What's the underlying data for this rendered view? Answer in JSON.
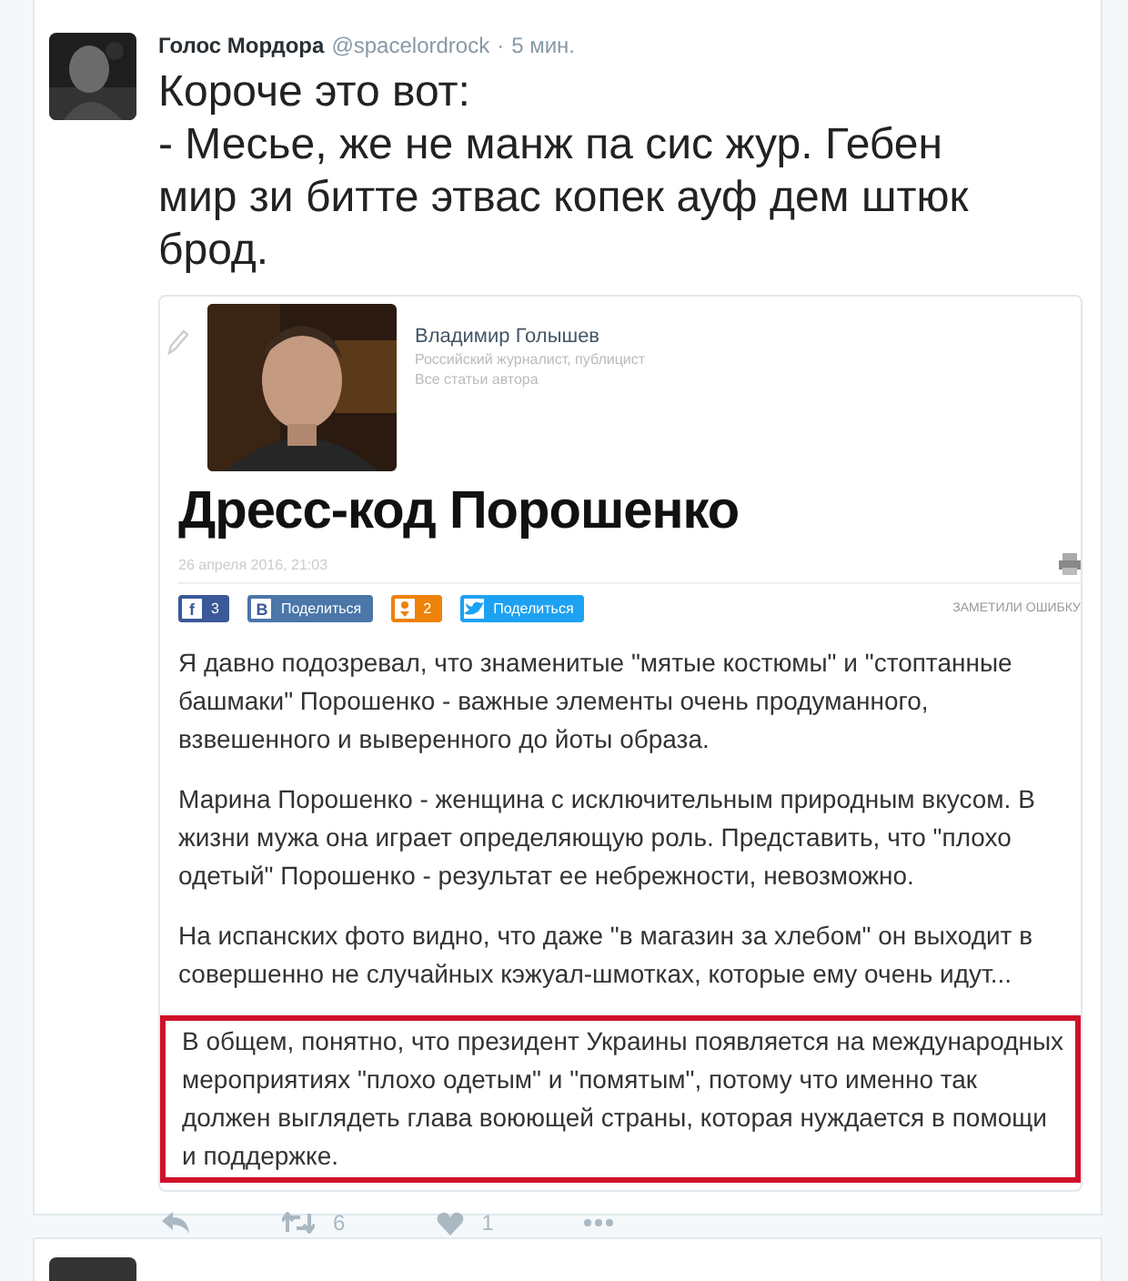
{
  "tweet": {
    "author": "Голос Мордора",
    "handle": "@spacelordrock",
    "separator": "·",
    "time": "5 мин.",
    "text_lines": [
      "Короче это вот:",
      "- Месье, же не манж па сис жур. Гебен мир зи битте этвас копек ауф дем штюк брод."
    ],
    "article": {
      "author_name": "Владимир Голышев",
      "author_bio": "Российский журналист, публицист",
      "author_link": "Все статьи автора",
      "headline": "Дресс-код Порошенко",
      "date": "26 апреля 2016, 21:03",
      "shares": [
        {
          "kind": "facebook",
          "icon": "f",
          "label": "3"
        },
        {
          "kind": "vk",
          "icon": "В",
          "label": "Поделиться"
        },
        {
          "kind": "ok",
          "label": "2"
        },
        {
          "kind": "twitter",
          "label": "Поделиться"
        }
      ],
      "report_link": "ЗАМЕТИЛИ ОШИБКУ",
      "paragraphs": [
        {
          "text": "Я давно подозревал, что знаменитые \"мятые костюмы\" и \"стоптанные башмаки\" Порошенко - важные элементы очень продуманного, взвешенного и выверенного до йоты образа.",
          "highlighted": false
        },
        {
          "text": "Марина Порошенко - женщина с исключительным природным вкусом. В жизни мужа она играет определяющую роль. Представить, что \"плохо одетый\" Порошенко - результат ее небрежности, невозможно.",
          "highlighted": false
        },
        {
          "text": "На испанских фото видно, что даже \"в магазин за хлебом\" он выходит в совершенно не случайных кэжуал-шмотках, которые ему очень идут...",
          "highlighted": false
        },
        {
          "text": "В общем, понятно, что президент Украины появляется на международных мероприятиях \"плохо одетым\" и \"помятым\", потому что именно так должен выглядеть глава воюющей страны, которая нуждается в помощи и поддержке.",
          "highlighted": true
        }
      ]
    },
    "actions": [
      {
        "kind": "reply"
      },
      {
        "kind": "retweet",
        "count": "6"
      },
      {
        "kind": "like",
        "count": "1"
      },
      {
        "kind": "more"
      }
    ]
  }
}
